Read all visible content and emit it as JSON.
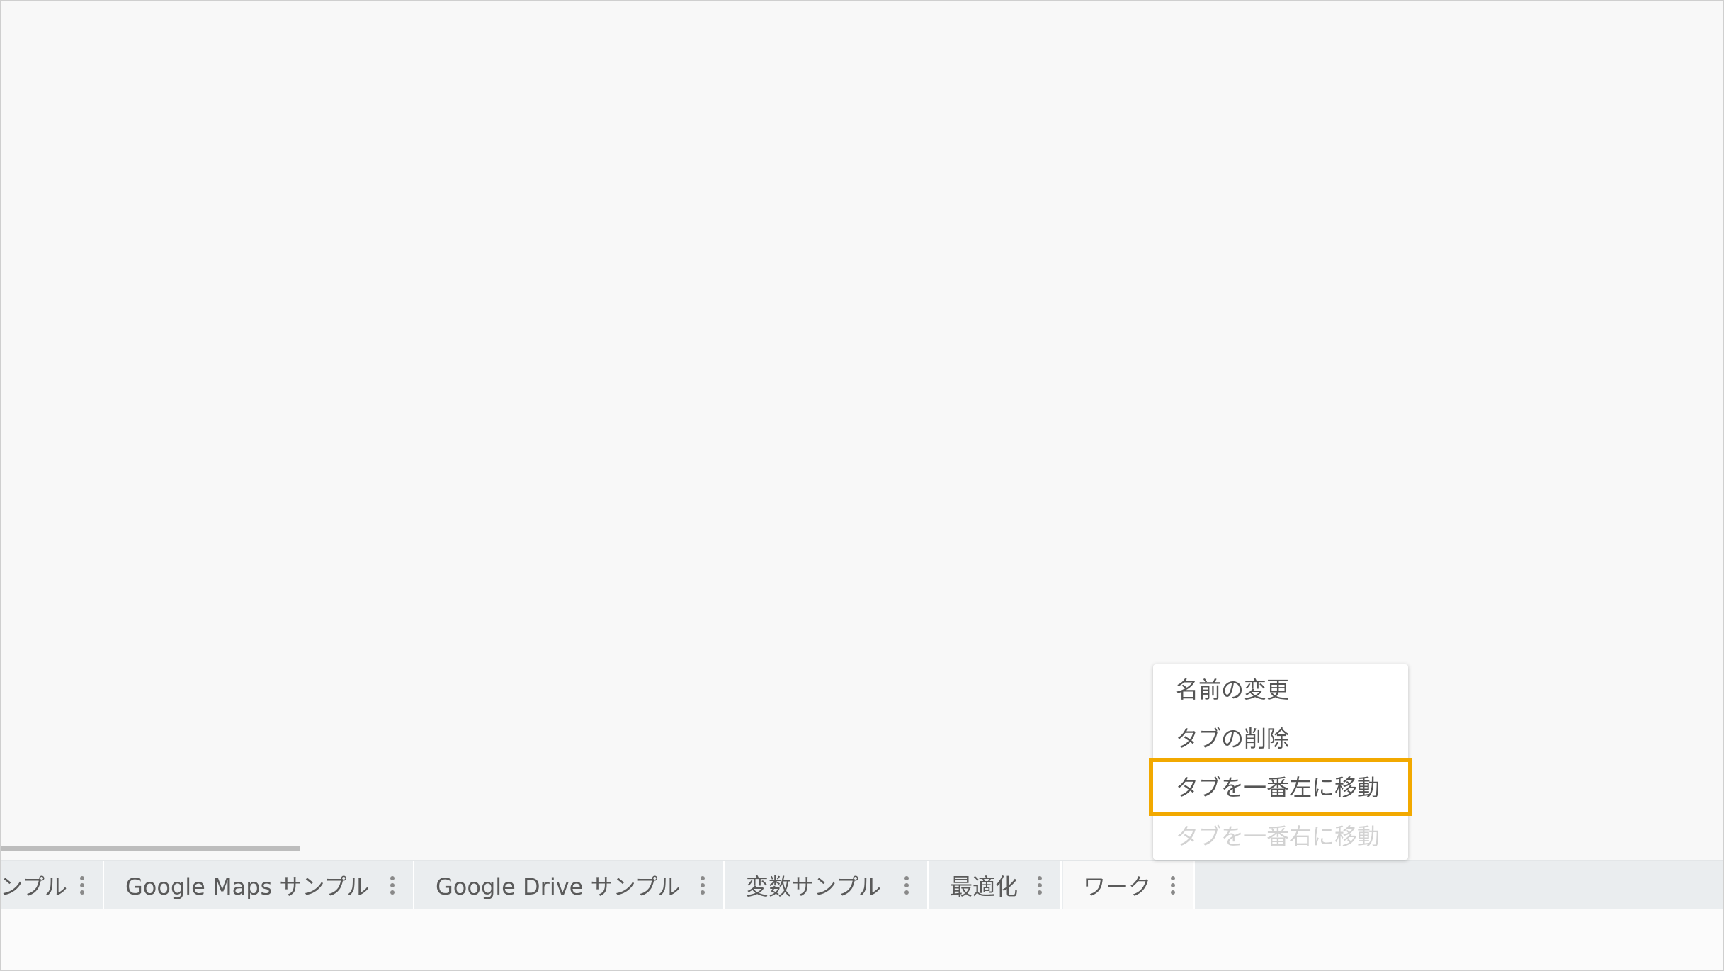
{
  "tabs": [
    {
      "label": "ンプル"
    },
    {
      "label": "Google Maps サンプル"
    },
    {
      "label": "Google Drive サンプル"
    },
    {
      "label": "変数サンプル"
    },
    {
      "label": "最適化"
    },
    {
      "label": "ワーク"
    }
  ],
  "context_menu": {
    "items": [
      {
        "label": "名前の変更",
        "enabled": true
      },
      {
        "label": "タブの削除",
        "enabled": true
      },
      {
        "label": "タブを一番左に移動",
        "enabled": true,
        "highlighted": true
      },
      {
        "label": "タブを一番右に移動",
        "enabled": false
      }
    ]
  },
  "colors": {
    "highlight": "#f2a900",
    "tabbar": "#eaedef",
    "canvas": "#f8f8f8"
  },
  "icons": {
    "tab_menu": "kebab-menu-icon"
  }
}
